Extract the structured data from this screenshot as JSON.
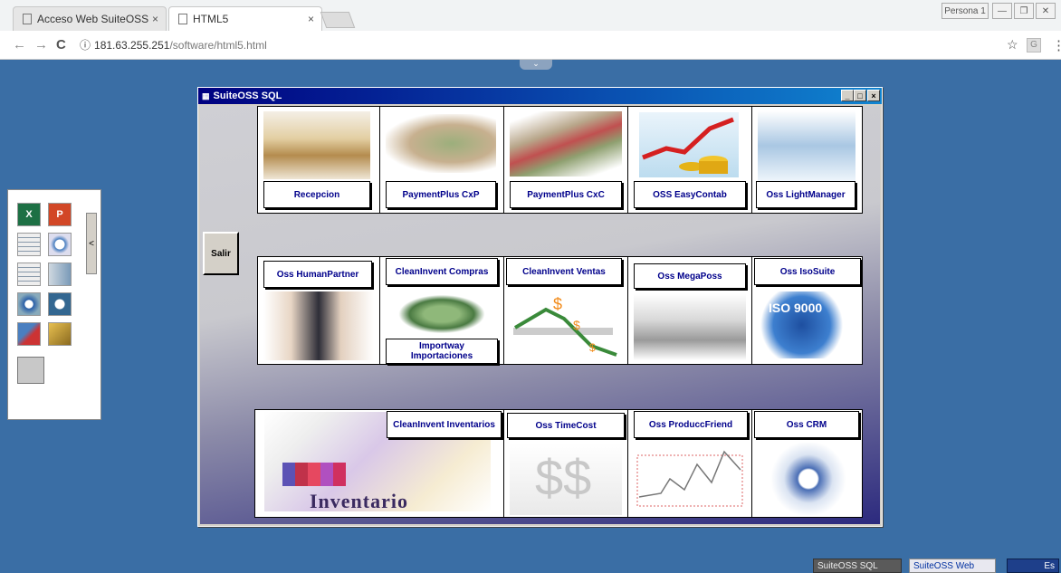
{
  "browser": {
    "tabs": [
      {
        "label": "Acceso Web SuiteOSS",
        "close": "×"
      },
      {
        "label": "HTML5",
        "close": "×"
      }
    ],
    "profile": "Persona 1",
    "window_controls": [
      "—",
      "❐",
      "✕"
    ],
    "nav": {
      "back": "←",
      "forward": "→",
      "reload": "C"
    },
    "url": {
      "info": "ⓘ",
      "host": "181.63.255.251",
      "path": "/software/html5.html"
    },
    "star": "☆",
    "ext": "G",
    "menu": "⋮",
    "pulldown": "⌄"
  },
  "left_panel": {
    "toggle": "<",
    "icons": [
      "excel-icon",
      "powerpoint-icon",
      "suiteoss-grid-icon",
      "clock-icon",
      "suiteoss-grid2-icon",
      "server-icon",
      "thunderbird-icon",
      "pgadmin-icon",
      "tool-icon",
      "folder-icon",
      "blank-icon"
    ],
    "icon_labels": {
      "excel": "X",
      "powerpoint": "P"
    }
  },
  "app": {
    "title": "SuiteOSS SQL",
    "title_buttons": [
      "_",
      "□",
      "×"
    ],
    "salir": "Salir",
    "row1": [
      "Recepcion",
      "PaymentPlus CxP",
      "PaymentPlus CxC",
      "OSS EasyContab",
      "Oss LightManager"
    ],
    "row2": [
      "Oss HumanPartner",
      "CleanInvent Compras",
      "CleanInvent Ventas",
      "Oss MegaPoss",
      "Oss IsoSuite"
    ],
    "row2_extra": "Importway Importaciones",
    "row3": [
      "CleanInvent Inventarios",
      "Oss TimeCost",
      "Oss ProduccFriend",
      "Oss CRM"
    ],
    "inventario_word": "Inventario",
    "iso_text": "ISO 9000"
  },
  "taskbar": {
    "items": [
      "SuiteOSS SQL",
      "SuiteOSS Web"
    ],
    "tray": "Es"
  }
}
